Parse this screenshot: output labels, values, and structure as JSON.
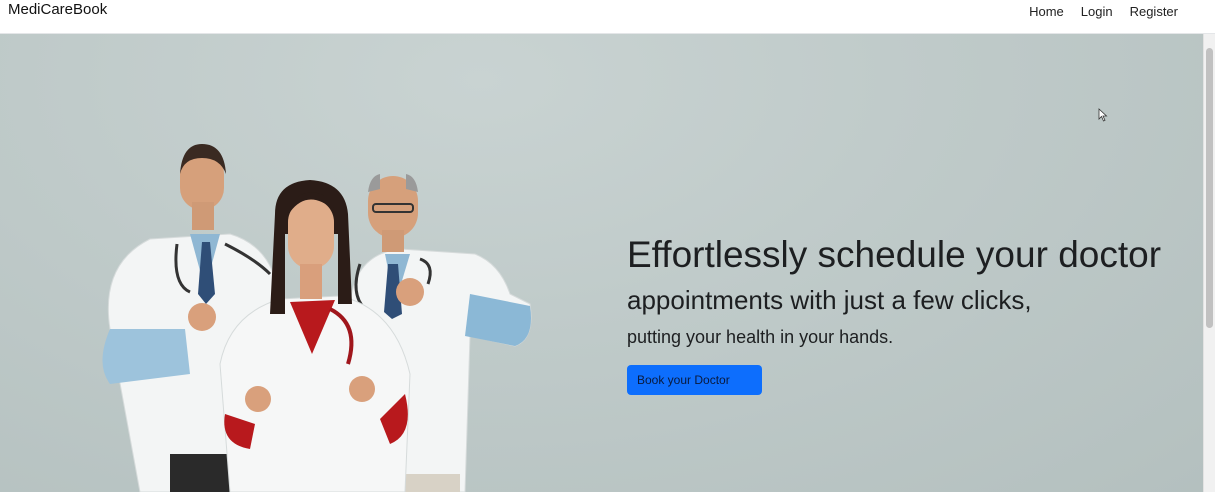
{
  "navbar": {
    "brand": "MediCareBook",
    "links": [
      "Home",
      "Login",
      "Register"
    ]
  },
  "hero": {
    "headline": "Effortlessly schedule your doctor",
    "subline": "appointments with just a few clicks,",
    "tagline": "putting your health in your hands.",
    "cta_label": "Book your Doctor"
  },
  "colors": {
    "primary_button": "#0d6efd",
    "hero_background": "#bfcac9",
    "navbar_background": "#ffffff"
  },
  "icons": [
    "mouse-cursor-icon"
  ]
}
